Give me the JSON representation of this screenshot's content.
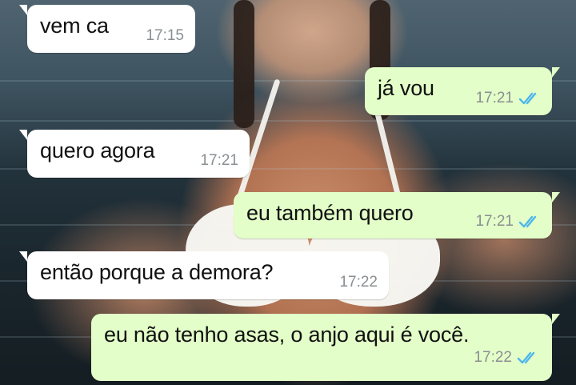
{
  "conversation": {
    "messages": [
      {
        "direction": "incoming",
        "text": "vem ca",
        "time": "17:15"
      },
      {
        "direction": "outgoing",
        "text": "já vou",
        "time": "17:21",
        "status_icon": "double-check-read-icon"
      },
      {
        "direction": "incoming",
        "text": "quero agora",
        "time": "17:21"
      },
      {
        "direction": "outgoing",
        "text": "eu também quero",
        "time": "17:21",
        "status_icon": "double-check-read-icon"
      },
      {
        "direction": "incoming",
        "text": "então porque a demora?",
        "time": "17:22"
      },
      {
        "direction": "outgoing",
        "text": "eu não tenho asas, o anjo aqui é você.",
        "time": "17:22",
        "status_icon": "double-check-read-icon"
      }
    ]
  },
  "theme": {
    "incoming_bubble": "#ffffff",
    "outgoing_bubble": "#e3fec8",
    "timestamp_color": "#8a8f92",
    "read_check_color": "#4fb6ec",
    "background_image": "woman in white bikini in water"
  }
}
